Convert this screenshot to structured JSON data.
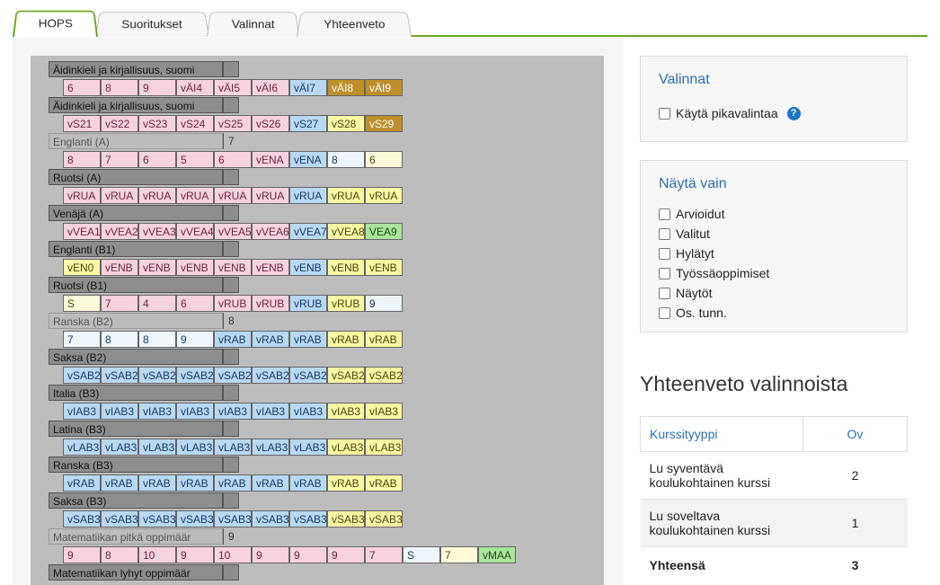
{
  "tabs": [
    {
      "label": "HOPS",
      "active": true
    },
    {
      "label": "Suoritukset",
      "active": false
    },
    {
      "label": "Valinnat",
      "active": false
    },
    {
      "label": "Yhteenveto",
      "active": false
    }
  ],
  "subjects": [
    {
      "name": "Äidinkieli ja kirjallisuus, suomi",
      "style": "dark",
      "count": "",
      "courses": [
        {
          "t": "6",
          "c": "pink"
        },
        {
          "t": "8",
          "c": "pink"
        },
        {
          "t": "9",
          "c": "pink"
        },
        {
          "t": "vÄI4",
          "c": "pink"
        },
        {
          "t": "vÄI5",
          "c": "pink"
        },
        {
          "t": "vÄI6",
          "c": "pink"
        },
        {
          "t": "vÄI7",
          "c": "blue"
        },
        {
          "t": "vÄI8",
          "c": "gold"
        },
        {
          "t": "vÄI9",
          "c": "gold"
        }
      ]
    },
    {
      "name": "Äidinkieli ja kirjallisuus, suomi",
      "style": "dark",
      "count": "",
      "courses": [
        {
          "t": "vS21",
          "c": "pink"
        },
        {
          "t": "vS22",
          "c": "pink"
        },
        {
          "t": "vS23",
          "c": "pink"
        },
        {
          "t": "vS24",
          "c": "pink"
        },
        {
          "t": "vS25",
          "c": "pink"
        },
        {
          "t": "vS26",
          "c": "pink"
        },
        {
          "t": "vS27",
          "c": "blue"
        },
        {
          "t": "vS28",
          "c": "yellow"
        },
        {
          "t": "vS29",
          "c": "gold"
        }
      ]
    },
    {
      "name": "Englanti (A)",
      "style": "light",
      "count": "7",
      "courses": [
        {
          "t": "8",
          "c": "pink"
        },
        {
          "t": "7",
          "c": "pink"
        },
        {
          "t": "6",
          "c": "pink"
        },
        {
          "t": "5",
          "c": "pink"
        },
        {
          "t": "6",
          "c": "pink"
        },
        {
          "t": "vENA",
          "c": "pink"
        },
        {
          "t": "vENA",
          "c": "blue"
        },
        {
          "t": "8",
          "c": "white"
        },
        {
          "t": "6",
          "c": "ivory"
        }
      ]
    },
    {
      "name": "Ruotsi (A)",
      "style": "dark",
      "count": "",
      "courses": [
        {
          "t": "vRUA",
          "c": "pink"
        },
        {
          "t": "vRUA",
          "c": "pink"
        },
        {
          "t": "vRUA",
          "c": "pink"
        },
        {
          "t": "vRUA",
          "c": "pink"
        },
        {
          "t": "vRUA",
          "c": "pink"
        },
        {
          "t": "vRUA",
          "c": "pink"
        },
        {
          "t": "vRUA",
          "c": "blue"
        },
        {
          "t": "vRUA",
          "c": "yellow"
        },
        {
          "t": "vRUA",
          "c": "yellow"
        }
      ]
    },
    {
      "name": "Venäjä (A)",
      "style": "dark",
      "count": "",
      "courses": [
        {
          "t": "vVEA1",
          "c": "pink"
        },
        {
          "t": "vVEA2",
          "c": "pink"
        },
        {
          "t": "vVEA3",
          "c": "pink"
        },
        {
          "t": "vVEA4",
          "c": "pink"
        },
        {
          "t": "vVEA5",
          "c": "pink"
        },
        {
          "t": "vVEA6",
          "c": "pink"
        },
        {
          "t": "vVEA7",
          "c": "blue"
        },
        {
          "t": "vVEA8",
          "c": "yellow"
        },
        {
          "t": "VEA9",
          "c": "green"
        }
      ]
    },
    {
      "name": "Englanti (B1)",
      "style": "dark",
      "count": "",
      "courses": [
        {
          "t": "vEN0",
          "c": "yellow"
        },
        {
          "t": "vENB",
          "c": "pink"
        },
        {
          "t": "vENB",
          "c": "pink"
        },
        {
          "t": "vENB",
          "c": "pink"
        },
        {
          "t": "vENB",
          "c": "pink"
        },
        {
          "t": "vENB",
          "c": "pink"
        },
        {
          "t": "vENB",
          "c": "blue"
        },
        {
          "t": "vENB",
          "c": "yellow"
        },
        {
          "t": "vENB",
          "c": "yellow"
        }
      ]
    },
    {
      "name": "Ruotsi (B1)",
      "style": "dark",
      "count": "",
      "courses": [
        {
          "t": "S",
          "c": "ivory"
        },
        {
          "t": "7",
          "c": "pink"
        },
        {
          "t": "4",
          "c": "pink"
        },
        {
          "t": "6",
          "c": "pink"
        },
        {
          "t": "vRUB",
          "c": "pink"
        },
        {
          "t": "vRUB",
          "c": "pink"
        },
        {
          "t": "vRUB",
          "c": "blue"
        },
        {
          "t": "vRUB",
          "c": "yellow"
        },
        {
          "t": "9",
          "c": "white"
        }
      ]
    },
    {
      "name": "Ranska (B2)",
      "style": "light",
      "count": "8",
      "courses": [
        {
          "t": "7",
          "c": "white"
        },
        {
          "t": "8",
          "c": "white"
        },
        {
          "t": "8",
          "c": "white"
        },
        {
          "t": "9",
          "c": "white"
        },
        {
          "t": "vRAB",
          "c": "blue"
        },
        {
          "t": "vRAB",
          "c": "blue"
        },
        {
          "t": "vRAB",
          "c": "blue"
        },
        {
          "t": "vRAB",
          "c": "yellow"
        },
        {
          "t": "vRAB",
          "c": "yellow"
        }
      ]
    },
    {
      "name": "Saksa (B2)",
      "style": "dark",
      "count": "",
      "courses": [
        {
          "t": "vSAB2",
          "c": "blue"
        },
        {
          "t": "vSAB2",
          "c": "blue"
        },
        {
          "t": "vSAB2",
          "c": "blue"
        },
        {
          "t": "vSAB2",
          "c": "blue"
        },
        {
          "t": "vSAB2",
          "c": "blue"
        },
        {
          "t": "vSAB2",
          "c": "blue"
        },
        {
          "t": "vSAB2",
          "c": "blue"
        },
        {
          "t": "vSAB2",
          "c": "yellow"
        },
        {
          "t": "vSAB2",
          "c": "yellow"
        }
      ]
    },
    {
      "name": "Italia (B3)",
      "style": "dark",
      "count": "",
      "courses": [
        {
          "t": "vIAB3",
          "c": "blue"
        },
        {
          "t": "vIAB3",
          "c": "blue"
        },
        {
          "t": "vIAB3",
          "c": "blue"
        },
        {
          "t": "vIAB3",
          "c": "blue"
        },
        {
          "t": "vIAB3",
          "c": "blue"
        },
        {
          "t": "vIAB3",
          "c": "blue"
        },
        {
          "t": "vIAB3",
          "c": "blue"
        },
        {
          "t": "vIAB3",
          "c": "yellow"
        },
        {
          "t": "vIAB3",
          "c": "yellow"
        }
      ]
    },
    {
      "name": "Latina (B3)",
      "style": "dark",
      "count": "",
      "courses": [
        {
          "t": "vLAB3",
          "c": "blue"
        },
        {
          "t": "vLAB3",
          "c": "blue"
        },
        {
          "t": "vLAB3",
          "c": "blue"
        },
        {
          "t": "vLAB3",
          "c": "blue"
        },
        {
          "t": "vLAB3",
          "c": "blue"
        },
        {
          "t": "vLAB3",
          "c": "blue"
        },
        {
          "t": "vLAB3",
          "c": "blue"
        },
        {
          "t": "vLAB3",
          "c": "yellow"
        },
        {
          "t": "vLAB3",
          "c": "yellow"
        }
      ]
    },
    {
      "name": "Ranska (B3)",
      "style": "dark",
      "count": "",
      "courses": [
        {
          "t": "vRAB",
          "c": "blue"
        },
        {
          "t": "vRAB",
          "c": "blue"
        },
        {
          "t": "vRAB",
          "c": "blue"
        },
        {
          "t": "vRAB",
          "c": "blue"
        },
        {
          "t": "vRAB",
          "c": "blue"
        },
        {
          "t": "vRAB",
          "c": "blue"
        },
        {
          "t": "vRAB",
          "c": "blue"
        },
        {
          "t": "vRAB",
          "c": "yellow"
        },
        {
          "t": "vRAB",
          "c": "yellow"
        }
      ]
    },
    {
      "name": "Saksa (B3)",
      "style": "dark",
      "count": "",
      "courses": [
        {
          "t": "vSAB3",
          "c": "blue"
        },
        {
          "t": "vSAB3",
          "c": "blue"
        },
        {
          "t": "vSAB3",
          "c": "blue"
        },
        {
          "t": "vSAB3",
          "c": "blue"
        },
        {
          "t": "vSAB3",
          "c": "blue"
        },
        {
          "t": "vSAB3",
          "c": "blue"
        },
        {
          "t": "vSAB3",
          "c": "blue"
        },
        {
          "t": "vSAB3",
          "c": "yellow"
        },
        {
          "t": "vSAB3",
          "c": "yellow"
        }
      ]
    },
    {
      "name": "Matematiikan pitkä oppimäär",
      "style": "light",
      "count": "9",
      "courses": [
        {
          "t": "9",
          "c": "pink"
        },
        {
          "t": "8",
          "c": "pink"
        },
        {
          "t": "10",
          "c": "pink"
        },
        {
          "t": "9",
          "c": "pink"
        },
        {
          "t": "10",
          "c": "pink"
        },
        {
          "t": "9",
          "c": "pink"
        },
        {
          "t": "9",
          "c": "pink"
        },
        {
          "t": "9",
          "c": "pink"
        },
        {
          "t": "7",
          "c": "pink"
        },
        {
          "t": "S",
          "c": "white"
        },
        {
          "t": "7",
          "c": "ivory"
        },
        {
          "t": "vMAA",
          "c": "green"
        }
      ]
    },
    {
      "name": "Matematiikan lyhyt oppimäär",
      "style": "dark",
      "count": "",
      "courses": []
    }
  ],
  "valinnat": {
    "title": "Valinnat",
    "quick_label": "Käytä pikavalintaa",
    "help": "?"
  },
  "filters": {
    "title": "Näytä vain",
    "items": [
      "Arvioidut",
      "Valitut",
      "Hylätyt",
      "Työssäoppimiset",
      "Näytöt",
      "Os. tunn."
    ]
  },
  "summary": {
    "title": "Yhteenveto valinnoista",
    "headers": [
      "Kurssityyppi",
      "Ov"
    ],
    "rows": [
      {
        "type": "Lu syventävä koulukohtainen kurssi",
        "ov": "2"
      },
      {
        "type": "Lu soveltava koulukohtainen kurssi",
        "ov": "1"
      }
    ],
    "total_label": "Yhteensä",
    "total_value": "3"
  }
}
